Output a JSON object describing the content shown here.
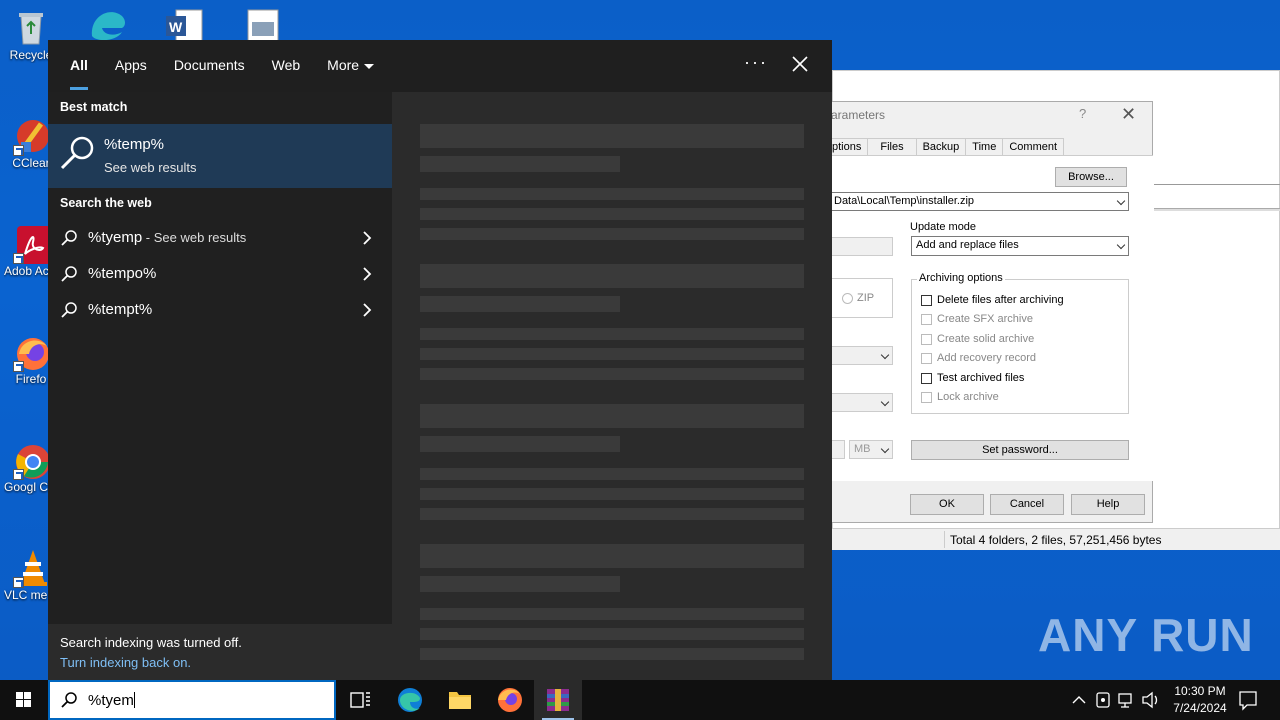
{
  "desktop": {
    "icons": [
      {
        "label": "Recycle",
        "icon": "recycle-bin-icon"
      },
      {
        "label": "CClear",
        "icon": "ccleaner-icon"
      },
      {
        "label": "Adob Acrob",
        "icon": "acrobat-icon"
      },
      {
        "label": "Firefo",
        "icon": "firefox-icon"
      },
      {
        "label": "Googl Chrom",
        "icon": "chrome-icon"
      },
      {
        "label": "VLC me playe",
        "icon": "vlc-icon"
      }
    ]
  },
  "background_window": {
    "dialog_title": "arameters",
    "tabs": [
      "ptions",
      "Files",
      "Backup",
      "Time",
      "Comment"
    ],
    "browse_label": "Browse...",
    "path_value": "Data\\Local\\Temp\\installer.zip",
    "update_mode_label": "Update mode",
    "update_mode_value": "Add and replace files",
    "zip_label": "ZIP",
    "archiving_options_label": "Archiving options",
    "options": [
      {
        "label": "Delete files after archiving",
        "enabled": true
      },
      {
        "label": "Create SFX archive",
        "enabled": false
      },
      {
        "label": "Create solid archive",
        "enabled": false
      },
      {
        "label": "Add recovery record",
        "enabled": false
      },
      {
        "label": "Test archived files",
        "enabled": true
      },
      {
        "label": "Lock archive",
        "enabled": false
      }
    ],
    "mb_label": "MB",
    "set_password_label": "Set password...",
    "ok_label": "OK",
    "cancel_label": "Cancel",
    "help_label": "Help",
    "status_text": "Total 4 folders, 2 files, 57,251,456 bytes"
  },
  "search": {
    "tabs": [
      "All",
      "Apps",
      "Documents",
      "Web",
      "More"
    ],
    "best_match_heading": "Best match",
    "best_match_title": "%temp%",
    "best_match_sub": "See web results",
    "search_web_heading": "Search the web",
    "web_results": [
      {
        "term": "%tyemp",
        "suffix": " - See web results"
      },
      {
        "term": "%tempo%",
        "suffix": ""
      },
      {
        "term": "%tempt%",
        "suffix": ""
      }
    ],
    "notice_line1": "Search indexing was turned off.",
    "notice_link": "Turn indexing back on."
  },
  "taskbar": {
    "search_value": "%tyem",
    "time": "10:30 PM",
    "date": "7/24/2024"
  },
  "watermark": "ANY RUN",
  "colors": {
    "accent": "#4ca0e0",
    "best_match_bg": "#1f3a56",
    "link": "#7fbff5"
  }
}
